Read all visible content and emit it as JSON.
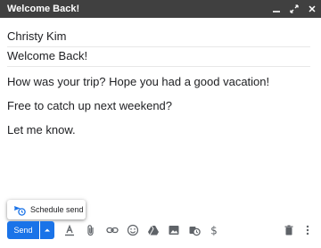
{
  "window": {
    "title": "Welcome Back!",
    "controls": [
      "minimize-icon",
      "expand-icon",
      "close-icon"
    ]
  },
  "compose": {
    "to": "Christy Kim",
    "subject": "Welcome Back!",
    "body": [
      "How was your trip? Hope you had a good vacation!",
      "Free to catch up next weekend?",
      "Let me know."
    ]
  },
  "schedule_popup": {
    "label": "Schedule send",
    "icon": "schedule-send-icon"
  },
  "toolbar": {
    "send_label": "Send",
    "icons": [
      "formatting-icon",
      "attach-icon",
      "link-icon",
      "emoji-icon",
      "drive-icon",
      "photo-icon",
      "confidential-icon",
      "money-icon",
      "trash-icon",
      "more-options-icon"
    ]
  },
  "colors": {
    "titlebar": "#404040",
    "accent": "#1a73e8",
    "text": "#202124",
    "icon": "#5f6368"
  }
}
